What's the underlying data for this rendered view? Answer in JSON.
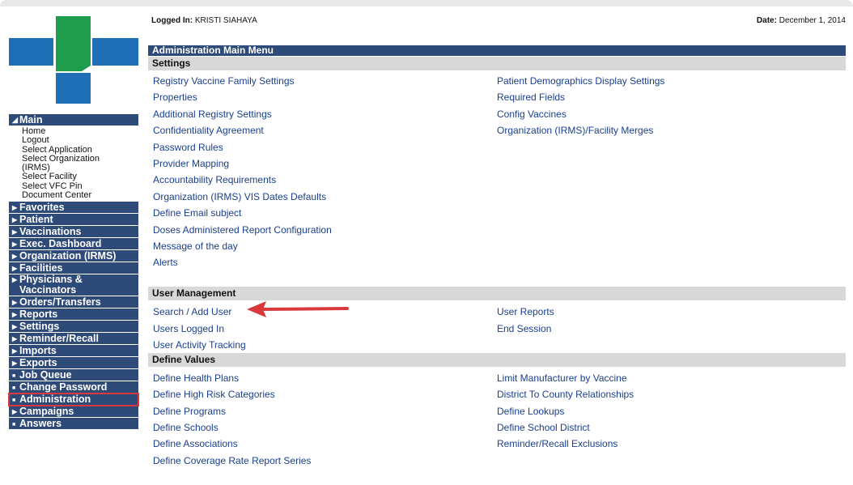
{
  "header": {
    "logged_in_label": "Logged In:",
    "user": "KRISTI SIAHAYA",
    "date_label": "Date:",
    "date": "December 1, 2014"
  },
  "menu_title": "Administration Main Menu",
  "sections": {
    "settings": {
      "title": "Settings",
      "col1": [
        "Registry Vaccine Family Settings",
        "Properties",
        "Additional Registry Settings",
        "Confidentiality Agreement",
        "Password Rules",
        "Provider Mapping",
        "Accountability Requirements",
        "Organization (IRMS) VIS Dates Defaults",
        "Define Email subject",
        "Doses Administered Report Configuration",
        "Message of the day",
        "Alerts"
      ],
      "col2": [
        "Patient Demographics Display Settings",
        "Required Fields",
        "Config Vaccines",
        "Organization (IRMS)/Facility Merges"
      ]
    },
    "user_management": {
      "title": "User Management",
      "col1": [
        "Search / Add User",
        "Users Logged In",
        "User Activity Tracking"
      ],
      "col2": [
        "User Reports",
        "End Session"
      ]
    },
    "define_values": {
      "title": "Define Values",
      "col1": [
        "Define Health Plans",
        "Define High Risk Categories",
        "Define Programs",
        "Define Schools",
        "Define Associations",
        "Define Coverage Rate Report Series"
      ],
      "col2": [
        "Limit Manufacturer by Vaccine",
        "District To County Relationships",
        "Define Lookups",
        "Define School District",
        "Reminder/Recall Exclusions"
      ]
    }
  },
  "sidebar": {
    "main_label": "Main",
    "main_items": [
      "Home",
      "Logout",
      "Select Application",
      "Select Organization",
      "(IRMS)",
      "Select Facility",
      "Select VFC Pin",
      "Document Center"
    ],
    "items": [
      "Favorites",
      "Patient",
      "Vaccinations",
      "Exec. Dashboard",
      "Organization (IRMS)",
      "Facilities",
      "Physicians &",
      "Vaccinators",
      "Orders/Transfers",
      "Reports",
      "Settings",
      "Reminder/Recall",
      "Imports",
      "Exports",
      "Job Queue",
      "Change Password",
      "Administration",
      "Campaigns",
      "Answers"
    ]
  },
  "colors": {
    "nav_blue": "#2e4a78",
    "link_blue": "#1a3f8f",
    "section_gray": "#d8d8d8",
    "highlight_red": "#d9383d",
    "logo_green": "#1e9e4c",
    "logo_blue": "#1f6fb7"
  }
}
